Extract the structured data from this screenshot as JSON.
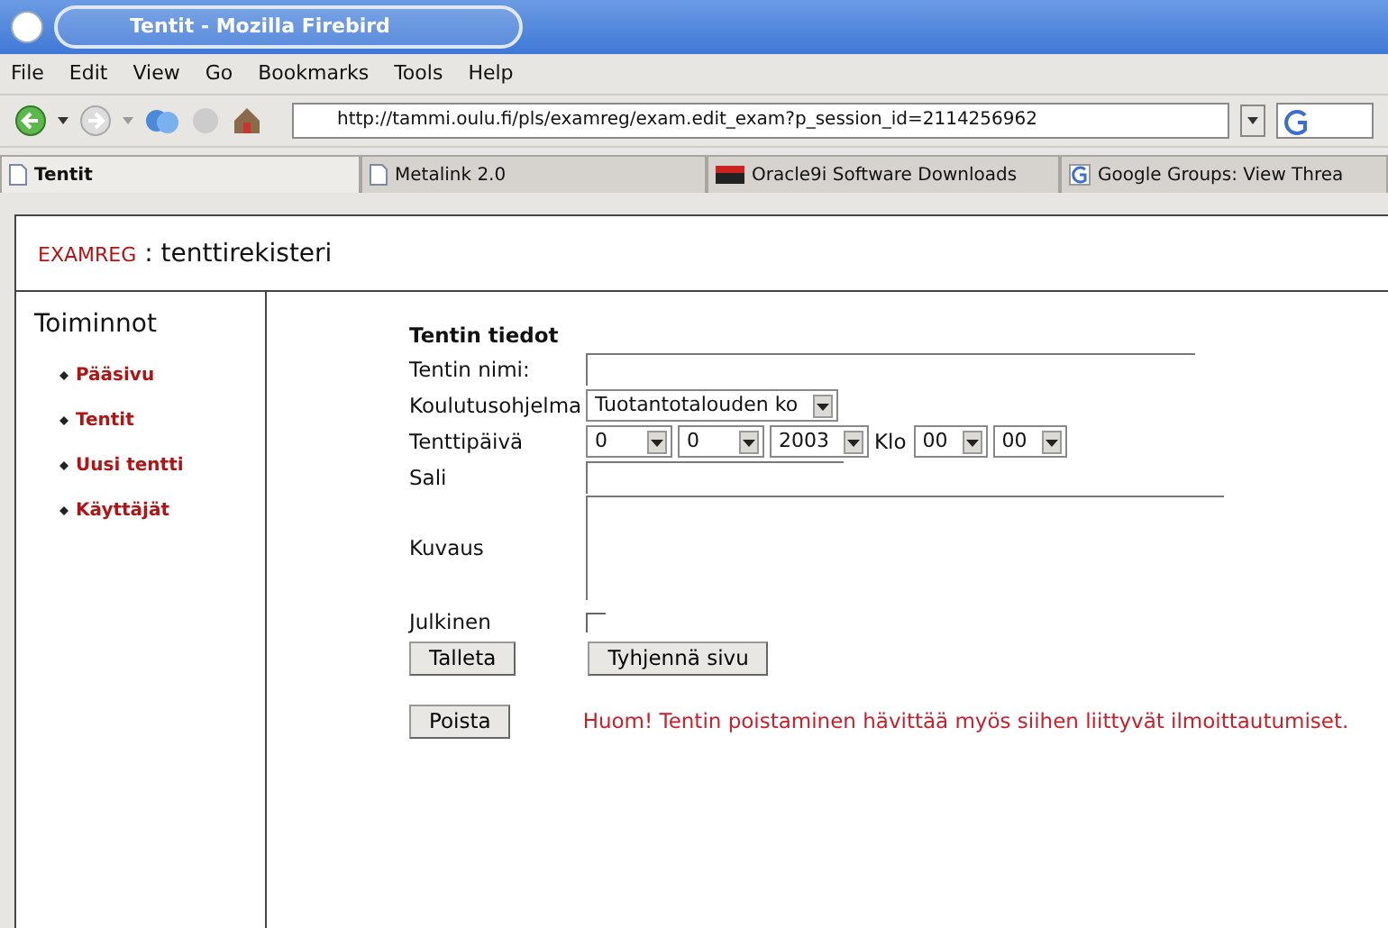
{
  "window": {
    "title": "Tentit - Mozilla Firebird"
  },
  "menu": [
    "File",
    "Edit",
    "View",
    "Go",
    "Bookmarks",
    "Tools",
    "Help"
  ],
  "address": {
    "value": "http://tammi.oulu.fi/pls/examreg/exam.edit_exam?p_session_id=2114256962"
  },
  "tabs": [
    {
      "label": "Tentit",
      "selected": true
    },
    {
      "label": "Metalink 2.0",
      "selected": false
    },
    {
      "label": "Oracle9i Software Downloads",
      "selected": false
    },
    {
      "label": "Google Groups: View Threa",
      "selected": false
    }
  ],
  "header": {
    "brand": "EXAMREG",
    "title": ": tenttirekisteri"
  },
  "sidebar": {
    "title": "Toiminnot",
    "items": [
      "Pääsivu",
      "Tentit",
      "Uusi tentti",
      "Käyttäjät"
    ]
  },
  "form": {
    "title": "Tentin tiedot",
    "fields": [
      {
        "kind": "text",
        "label": "Tentin nimi:"
      },
      {
        "kind": "select",
        "label": "Koulutusohjelma",
        "value": "Tuotantotalouden ko"
      },
      {
        "kind": "date",
        "label": "Tenttipäivä",
        "day": "0",
        "month": "0",
        "year": "2003",
        "time_label": "Klo",
        "hour": "00",
        "minute": "00"
      },
      {
        "kind": "text",
        "label": "Sali"
      },
      {
        "kind": "textarea",
        "label": "Kuvaus"
      },
      {
        "kind": "checkbox",
        "label": "Julkinen",
        "checked": false
      }
    ],
    "buttons": [
      "Talleta",
      "Tyhjennä sivu"
    ],
    "delete_button": "Poista",
    "warning": "Huom! Tentin poistaminen hävittää myös siihen liittyvät ilmoittautumiset."
  }
}
